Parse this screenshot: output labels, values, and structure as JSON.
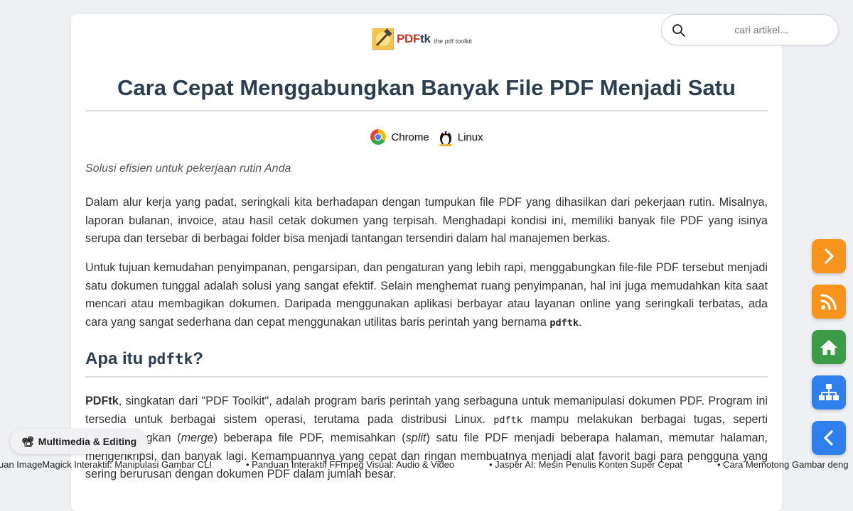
{
  "logo": {
    "word_main": "PDF",
    "word_tk": "tk",
    "tagline": "the pdf toolkit"
  },
  "article": {
    "title": "Cara Cepat Menggabungkan Banyak File PDF Menjadi Satu",
    "platforms": [
      "Chrome",
      "Linux"
    ],
    "subtitle": "Solusi efisien untuk pekerjaan rutin Anda",
    "p1": "Dalam alur kerja yang padat, seringkali kita berhadapan dengan tumpukan file PDF yang dihasilkan dari pekerjaan rutin. Misalnya, laporan bulanan, invoice, atau hasil cetak dokumen yang terpisah. Menghadapi kondisi ini, memiliki banyak file PDF yang isinya serupa dan tersebar di berbagai folder bisa menjadi tantangan tersendiri dalam hal manajemen berkas.",
    "p2_text": "Untuk tujuan kemudahan penyimpanan, pengarsipan, dan pengaturan yang lebih rapi, menggabungkan file-file PDF tersebut menjadi satu dokumen tunggal adalah solusi yang sangat efektif. Selain menghemat ruang penyimpanan, hal ini juga memudahkan kita saat mencari atau membagikan dokumen. Daripada menggunakan aplikasi berbayar atau layanan online yang seringkali terbatas, ada cara yang sangat sederhana dan cepat menggunakan utilitas baris perintah yang bernama ",
    "p2_code": "pdftk",
    "p2_end": ".",
    "h2_text": "Apa itu ",
    "h2_code": "pdftk",
    "h2_end": "?",
    "p3_bold": "PDFtk",
    "p3_a": ", singkatan dari \"PDF Toolkit\", adalah program baris perintah yang serbaguna untuk memanipulasi dokumen PDF. Program ini tersedia untuk berbagai sistem operasi, terutama pada distribusi Linux. ",
    "p3_code": "pdftk",
    "p3_b": " mampu melakukan berbagai tugas, seperti menggabungkan (",
    "p3_em1": "merge",
    "p3_c": ") beberapa file PDF, memisahkan (",
    "p3_em2": "split",
    "p3_d": ") satu file PDF menjadi beberapa halaman, memutar halaman, mengenkripsi, dan banyak lagi. Kemampuannya yang cepat dan ringan membuatnya menjadi alat favorit bagi para pengguna yang sering berurusan dengan dokumen PDF dalam jumlah besar."
  },
  "search": {
    "placeholder": "cari artikel..."
  },
  "category_chip": {
    "icon": "📽",
    "label": "Multimedia & Editing"
  },
  "ticker": [
    "uan ImageMagick Interaktif: Manipulasi Gambar CLI",
    "• Panduan Interaktif FFmpeg Visual: Audio & Video",
    "• Jasper AI: Mesin Penulis Konten Super Cepat",
    "• Cara Memotong Gambar deng"
  ],
  "fab_buttons": [
    {
      "name": "next-button",
      "icon": "chevron-right-icon",
      "color": "#f7941d"
    },
    {
      "name": "rss-button",
      "icon": "rss-icon",
      "color": "#f7941d"
    },
    {
      "name": "home-button",
      "icon": "home-icon",
      "color": "#3d9b47"
    },
    {
      "name": "sitemap-button",
      "icon": "sitemap-icon",
      "color": "#2f80ed"
    },
    {
      "name": "back-button",
      "icon": "chevron-left-icon",
      "color": "#2f80ed"
    }
  ],
  "colors": {
    "heading": "#2c3e50",
    "orange": "#f7941d",
    "green": "#3d9b47",
    "blue": "#2f80ed"
  }
}
